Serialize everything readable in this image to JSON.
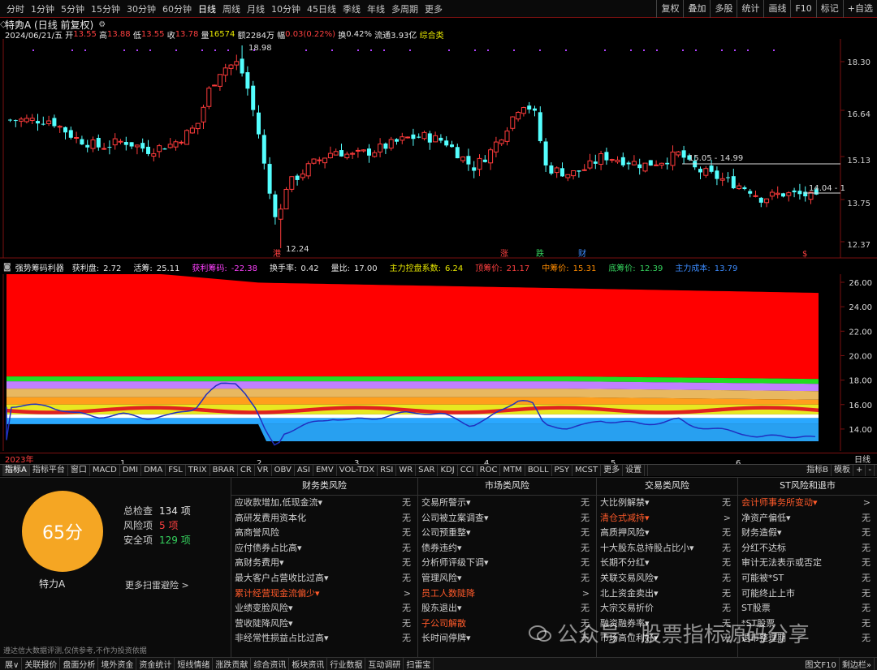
{
  "period_tabs": [
    "分时",
    "1分钟",
    "5分钟",
    "15分钟",
    "30分钟",
    "60分钟",
    "日线",
    "周线",
    "月线",
    "10分钟",
    "45日线",
    "季线",
    "年线",
    "多周期",
    "更多"
  ],
  "active_period": "日线",
  "toolbar_right": [
    "复权",
    "叠加",
    "多股",
    "统计",
    "画线",
    "F10",
    "标记",
    "+自选"
  ],
  "title": "特力A (日线 前复权)",
  "quote": {
    "date": "2024/06/21/五",
    "open_label": "开",
    "open": "13.55",
    "high_label": "高",
    "high": "13.88",
    "low_label": "低",
    "low": "13.55",
    "close_label": "收",
    "close": "13.78",
    "vol_label": "量",
    "vol": "16574",
    "amt_label": "额",
    "amt": "2284万",
    "chg_label": "幅",
    "chg": "0.03(0.22%)",
    "turn_label": "换",
    "turn": "0.42%",
    "float_label": "流通",
    "float": "3.93亿",
    "concept": "综合类"
  },
  "price_axis": [
    "18.30",
    "16.64",
    "15.13",
    "13.75",
    "12.37"
  ],
  "price_annotations": {
    "high": "18.98",
    "low": "12.24",
    "level1": "15.05 - 14.99",
    "level2": "14.04 - 1"
  },
  "event_markers": [
    "港",
    "涨",
    "跌",
    "财",
    "$"
  ],
  "indicator2": {
    "name": "强势筹码利器",
    "items": [
      {
        "label": "获利盘:",
        "value": "2.72",
        "color": "#e6e6e6"
      },
      {
        "label": "活筹:",
        "value": "25.11",
        "color": "#e6e6e6"
      },
      {
        "label": "获利筹码:",
        "value": "-22.38",
        "color": "#ff40ff"
      },
      {
        "label": "换手率:",
        "value": "0.42",
        "color": "#e6e6e6"
      },
      {
        "label": "量比:",
        "value": "17.00",
        "color": "#e6e6e6"
      },
      {
        "label": "主力控盘系数:",
        "value": "6.24",
        "color": "#e8e800"
      },
      {
        "label": "顶筹价:",
        "value": "21.17",
        "color": "#ff4040"
      },
      {
        "label": "中筹价:",
        "value": "15.31",
        "color": "#ff8c00"
      },
      {
        "label": "底筹价:",
        "value": "12.39",
        "color": "#35d35e"
      },
      {
        "label": "主力成本:",
        "value": "13.79",
        "color": "#3c8cff"
      }
    ]
  },
  "chip_axis": [
    "26.00",
    "24.00",
    "22.00",
    "20.00",
    "18.00",
    "16.00",
    "14.00"
  ],
  "time_axis": {
    "start": "2023年",
    "months": [
      "1",
      "2",
      "3",
      "4",
      "5",
      "6"
    ],
    "period": "日线"
  },
  "indicator_tabs": [
    "指标A",
    "指标平台",
    "窗口",
    "MACD",
    "DMI",
    "DMA",
    "FSL",
    "TRIX",
    "BRAR",
    "CR",
    "VR",
    "OBV",
    "ASI",
    "EMV",
    "VOL-TDX",
    "RSI",
    "WR",
    "SAR",
    "KDJ",
    "CCI",
    "ROC",
    "MTM",
    "BOLL",
    "PSY",
    "MCST",
    "更多",
    "设置"
  ],
  "indicator_tabs_right": [
    "指标B",
    "模板",
    "+",
    "-"
  ],
  "scan": {
    "score": "65分",
    "stock": "特力A",
    "more": "更多扫雷避险 >",
    "rows": [
      {
        "label": "总检查",
        "value": "134 项",
        "color": "#e6e6e6"
      },
      {
        "label": "风险项",
        "value": "5 项",
        "color": "#ff4040"
      },
      {
        "label": "安全项",
        "value": "129 项",
        "color": "#35d35e"
      }
    ]
  },
  "risk_columns": [
    {
      "title": "财务类风险",
      "items": [
        {
          "t": "应收款增加,低现金流▾",
          "s": "无"
        },
        {
          "t": "高研发费用资本化",
          "s": "无"
        },
        {
          "t": "高商誉风险",
          "s": "无"
        },
        {
          "t": "应付债券占比高▾",
          "s": "无"
        },
        {
          "t": "高财务费用▾",
          "s": "无"
        },
        {
          "t": "最大客户占营收比过高▾",
          "s": "无"
        },
        {
          "t": "累计经营现金流偏少▾",
          "s": ">",
          "hot": true
        },
        {
          "t": "业绩变脸风险▾",
          "s": "无"
        },
        {
          "t": "营收陡降风险▾",
          "s": "无"
        },
        {
          "t": "非经常性损益占比过高▾",
          "s": "无"
        }
      ]
    },
    {
      "title": "市场类风险",
      "items": [
        {
          "t": "交易所警示▾",
          "s": "无"
        },
        {
          "t": "公司被立案调查▾",
          "s": "无"
        },
        {
          "t": "公司预重整▾",
          "s": "无"
        },
        {
          "t": "债券违约▾",
          "s": "无"
        },
        {
          "t": "分析师评级下调▾",
          "s": "无"
        },
        {
          "t": "管理风险▾",
          "s": "无"
        },
        {
          "t": "员工人数陡降",
          "s": ">",
          "hot": true
        },
        {
          "t": "股东退出▾",
          "s": "无"
        },
        {
          "t": "子公司解散",
          "s": "无",
          "hot": true
        },
        {
          "t": "长时间停牌▾",
          "s": "无"
        }
      ]
    },
    {
      "title": "交易类风险",
      "items": [
        {
          "t": "大比例解禁▾",
          "s": "无"
        },
        {
          "t": "清仓式减持▾",
          "s": ">",
          "hot": true
        },
        {
          "t": "高质押风险▾",
          "s": "无"
        },
        {
          "t": "十大股东总持股占比小▾",
          "s": "无"
        },
        {
          "t": "长期不分红▾",
          "s": "无"
        },
        {
          "t": "关联交易风险▾",
          "s": "无"
        },
        {
          "t": "北上资金卖出▾",
          "s": "无"
        },
        {
          "t": "大宗交易折价",
          "s": "无"
        },
        {
          "t": "融资融券率▾",
          "s": "无"
        },
        {
          "t": "市场高位利好▾",
          "s": "无"
        }
      ]
    },
    {
      "title": "ST风险和退市",
      "items": [
        {
          "t": "会计师事务所变动▾",
          "s": ">",
          "hot": true
        },
        {
          "t": "净资产偏低▾",
          "s": "无"
        },
        {
          "t": "财务造假▾",
          "s": "无"
        },
        {
          "t": "分红不达标",
          "s": "无"
        },
        {
          "t": "审计无法表示或否定",
          "s": "无"
        },
        {
          "t": "可能被*ST",
          "s": "无"
        },
        {
          "t": "可能终止上市",
          "s": "无"
        },
        {
          "t": "ST股票",
          "s": "无"
        },
        {
          "t": "*ST股票",
          "s": "无"
        },
        {
          "t": "退市整理期",
          "s": "无"
        }
      ]
    }
  ],
  "disclaimer": "遵达信大数据评测,仅供参考,不作为投资依据",
  "watermark": "公众号 · 股票指标源码分享",
  "status_tabs": [
    "展∨",
    "关联报价",
    "盘面分析",
    "境外资金",
    "资金统计",
    "短线情绪",
    "涨跌贡献",
    "综合资讯",
    "板块资讯",
    "行业数据",
    "互动调研",
    "扫雷宝"
  ],
  "status_right": [
    "图文F10",
    "剩边栏»"
  ]
}
